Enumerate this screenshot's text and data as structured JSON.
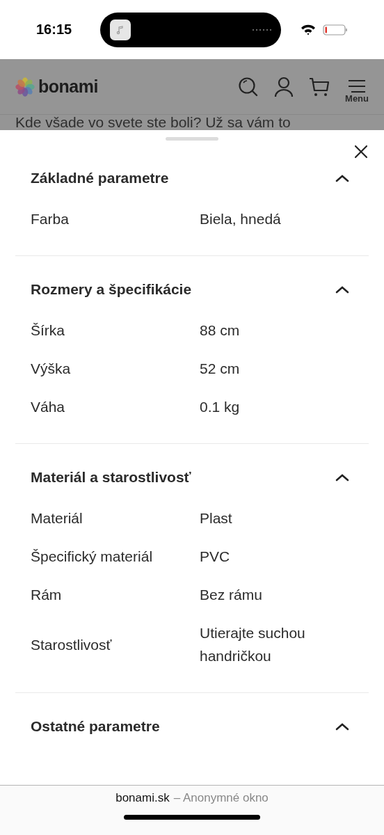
{
  "status_bar": {
    "time": "16:15"
  },
  "header": {
    "logo_text": "bonami",
    "menu_label": "Menu"
  },
  "background_text": "Kde všade vo svete ste boli? Už sa vám to",
  "sheet": {
    "sections": [
      {
        "title": "Základné parametre",
        "expanded": true,
        "rows": [
          {
            "label": "Farba",
            "value": "Biela, hnedá"
          }
        ]
      },
      {
        "title": "Rozmery a špecifikácie",
        "expanded": true,
        "rows": [
          {
            "label": "Šírka",
            "value": "88 cm"
          },
          {
            "label": "Výška",
            "value": "52 cm"
          },
          {
            "label": "Váha",
            "value": "0.1 kg"
          }
        ]
      },
      {
        "title": "Materiál a starostlivosť",
        "expanded": true,
        "rows": [
          {
            "label": "Materiál",
            "value": "Plast"
          },
          {
            "label": "Špecifický materiál",
            "value": "PVC"
          },
          {
            "label": "Rám",
            "value": "Bez rámu"
          },
          {
            "label": "Starostlivosť",
            "value": "Utierajte suchou handričkou"
          }
        ]
      },
      {
        "title": "Ostatné parametre",
        "expanded": true
      }
    ]
  },
  "browser_bar": {
    "domain": "bonami.sk",
    "mode": "– Anonymné okno"
  }
}
